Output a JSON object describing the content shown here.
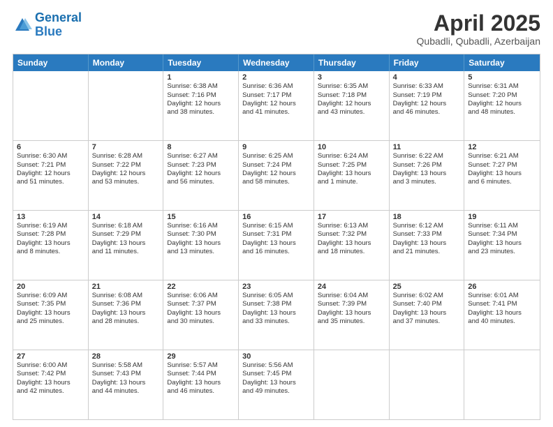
{
  "logo": {
    "line1": "General",
    "line2": "Blue"
  },
  "title": "April 2025",
  "location": "Qubadli, Qubadli, Azerbaijan",
  "days_of_week": [
    "Sunday",
    "Monday",
    "Tuesday",
    "Wednesday",
    "Thursday",
    "Friday",
    "Saturday"
  ],
  "weeks": [
    [
      {
        "day": "",
        "lines": []
      },
      {
        "day": "",
        "lines": []
      },
      {
        "day": "1",
        "lines": [
          "Sunrise: 6:38 AM",
          "Sunset: 7:16 PM",
          "Daylight: 12 hours",
          "and 38 minutes."
        ]
      },
      {
        "day": "2",
        "lines": [
          "Sunrise: 6:36 AM",
          "Sunset: 7:17 PM",
          "Daylight: 12 hours",
          "and 41 minutes."
        ]
      },
      {
        "day": "3",
        "lines": [
          "Sunrise: 6:35 AM",
          "Sunset: 7:18 PM",
          "Daylight: 12 hours",
          "and 43 minutes."
        ]
      },
      {
        "day": "4",
        "lines": [
          "Sunrise: 6:33 AM",
          "Sunset: 7:19 PM",
          "Daylight: 12 hours",
          "and 46 minutes."
        ]
      },
      {
        "day": "5",
        "lines": [
          "Sunrise: 6:31 AM",
          "Sunset: 7:20 PM",
          "Daylight: 12 hours",
          "and 48 minutes."
        ]
      }
    ],
    [
      {
        "day": "6",
        "lines": [
          "Sunrise: 6:30 AM",
          "Sunset: 7:21 PM",
          "Daylight: 12 hours",
          "and 51 minutes."
        ]
      },
      {
        "day": "7",
        "lines": [
          "Sunrise: 6:28 AM",
          "Sunset: 7:22 PM",
          "Daylight: 12 hours",
          "and 53 minutes."
        ]
      },
      {
        "day": "8",
        "lines": [
          "Sunrise: 6:27 AM",
          "Sunset: 7:23 PM",
          "Daylight: 12 hours",
          "and 56 minutes."
        ]
      },
      {
        "day": "9",
        "lines": [
          "Sunrise: 6:25 AM",
          "Sunset: 7:24 PM",
          "Daylight: 12 hours",
          "and 58 minutes."
        ]
      },
      {
        "day": "10",
        "lines": [
          "Sunrise: 6:24 AM",
          "Sunset: 7:25 PM",
          "Daylight: 13 hours",
          "and 1 minute."
        ]
      },
      {
        "day": "11",
        "lines": [
          "Sunrise: 6:22 AM",
          "Sunset: 7:26 PM",
          "Daylight: 13 hours",
          "and 3 minutes."
        ]
      },
      {
        "day": "12",
        "lines": [
          "Sunrise: 6:21 AM",
          "Sunset: 7:27 PM",
          "Daylight: 13 hours",
          "and 6 minutes."
        ]
      }
    ],
    [
      {
        "day": "13",
        "lines": [
          "Sunrise: 6:19 AM",
          "Sunset: 7:28 PM",
          "Daylight: 13 hours",
          "and 8 minutes."
        ]
      },
      {
        "day": "14",
        "lines": [
          "Sunrise: 6:18 AM",
          "Sunset: 7:29 PM",
          "Daylight: 13 hours",
          "and 11 minutes."
        ]
      },
      {
        "day": "15",
        "lines": [
          "Sunrise: 6:16 AM",
          "Sunset: 7:30 PM",
          "Daylight: 13 hours",
          "and 13 minutes."
        ]
      },
      {
        "day": "16",
        "lines": [
          "Sunrise: 6:15 AM",
          "Sunset: 7:31 PM",
          "Daylight: 13 hours",
          "and 16 minutes."
        ]
      },
      {
        "day": "17",
        "lines": [
          "Sunrise: 6:13 AM",
          "Sunset: 7:32 PM",
          "Daylight: 13 hours",
          "and 18 minutes."
        ]
      },
      {
        "day": "18",
        "lines": [
          "Sunrise: 6:12 AM",
          "Sunset: 7:33 PM",
          "Daylight: 13 hours",
          "and 21 minutes."
        ]
      },
      {
        "day": "19",
        "lines": [
          "Sunrise: 6:11 AM",
          "Sunset: 7:34 PM",
          "Daylight: 13 hours",
          "and 23 minutes."
        ]
      }
    ],
    [
      {
        "day": "20",
        "lines": [
          "Sunrise: 6:09 AM",
          "Sunset: 7:35 PM",
          "Daylight: 13 hours",
          "and 25 minutes."
        ]
      },
      {
        "day": "21",
        "lines": [
          "Sunrise: 6:08 AM",
          "Sunset: 7:36 PM",
          "Daylight: 13 hours",
          "and 28 minutes."
        ]
      },
      {
        "day": "22",
        "lines": [
          "Sunrise: 6:06 AM",
          "Sunset: 7:37 PM",
          "Daylight: 13 hours",
          "and 30 minutes."
        ]
      },
      {
        "day": "23",
        "lines": [
          "Sunrise: 6:05 AM",
          "Sunset: 7:38 PM",
          "Daylight: 13 hours",
          "and 33 minutes."
        ]
      },
      {
        "day": "24",
        "lines": [
          "Sunrise: 6:04 AM",
          "Sunset: 7:39 PM",
          "Daylight: 13 hours",
          "and 35 minutes."
        ]
      },
      {
        "day": "25",
        "lines": [
          "Sunrise: 6:02 AM",
          "Sunset: 7:40 PM",
          "Daylight: 13 hours",
          "and 37 minutes."
        ]
      },
      {
        "day": "26",
        "lines": [
          "Sunrise: 6:01 AM",
          "Sunset: 7:41 PM",
          "Daylight: 13 hours",
          "and 40 minutes."
        ]
      }
    ],
    [
      {
        "day": "27",
        "lines": [
          "Sunrise: 6:00 AM",
          "Sunset: 7:42 PM",
          "Daylight: 13 hours",
          "and 42 minutes."
        ]
      },
      {
        "day": "28",
        "lines": [
          "Sunrise: 5:58 AM",
          "Sunset: 7:43 PM",
          "Daylight: 13 hours",
          "and 44 minutes."
        ]
      },
      {
        "day": "29",
        "lines": [
          "Sunrise: 5:57 AM",
          "Sunset: 7:44 PM",
          "Daylight: 13 hours",
          "and 46 minutes."
        ]
      },
      {
        "day": "30",
        "lines": [
          "Sunrise: 5:56 AM",
          "Sunset: 7:45 PM",
          "Daylight: 13 hours",
          "and 49 minutes."
        ]
      },
      {
        "day": "",
        "lines": []
      },
      {
        "day": "",
        "lines": []
      },
      {
        "day": "",
        "lines": []
      }
    ]
  ]
}
